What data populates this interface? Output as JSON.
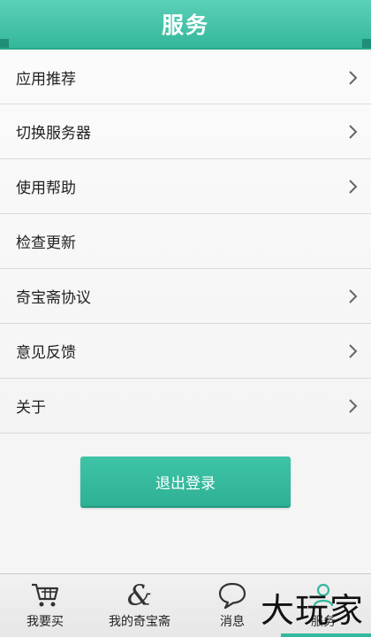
{
  "header": {
    "title": "服务"
  },
  "menu": {
    "items": [
      {
        "label": "应用推荐",
        "has_chevron": true
      },
      {
        "label": "切换服务器",
        "has_chevron": true
      },
      {
        "label": "使用帮助",
        "has_chevron": true
      },
      {
        "label": "检查更新",
        "has_chevron": false
      },
      {
        "label": "奇宝斋协议",
        "has_chevron": true
      },
      {
        "label": "意见反馈",
        "has_chevron": true
      },
      {
        "label": "关于",
        "has_chevron": true
      }
    ]
  },
  "logout": {
    "label": "退出登录"
  },
  "tabbar": {
    "tabs": [
      {
        "label": "我要买",
        "icon": "shopping-cart-icon"
      },
      {
        "label": "我的奇宝斋",
        "icon": "ampersand-icon"
      },
      {
        "label": "消息",
        "icon": "speech-bubble-icon"
      },
      {
        "label": "服务",
        "icon": "service-icon",
        "active": true
      }
    ]
  },
  "watermark": {
    "text": "大玩家"
  },
  "colors": {
    "accent": "#34b89c",
    "header_text": "#ffffff",
    "item_text": "#222222",
    "chevron": "#666666"
  }
}
